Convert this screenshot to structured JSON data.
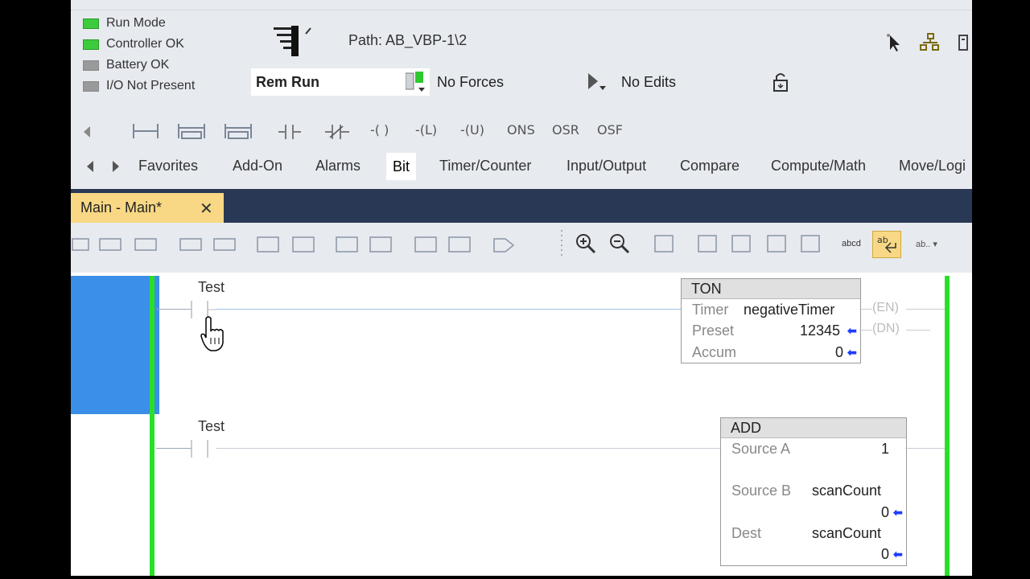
{
  "status": {
    "items": [
      {
        "label": "Run Mode",
        "color": "#3ccb3c"
      },
      {
        "label": "Controller OK",
        "color": "#3ccb3c"
      },
      {
        "label": "Battery OK",
        "color": "#9a9a9a"
      },
      {
        "label": "I/O Not Present",
        "color": "#9a9a9a"
      }
    ],
    "path": "Path:  AB_VBP-1\\2",
    "mode": "Rem Run",
    "forces": "No Forces",
    "edits": "No Edits"
  },
  "instructions": [
    "ONS",
    "OSR",
    "OSF"
  ],
  "palette_tabs": [
    "Favorites",
    "Add-On",
    "Alarms",
    "Bit",
    "Timer/Counter",
    "Input/Output",
    "Compare",
    "Compute/Math",
    "Move/Logi"
  ],
  "active_palette_tab": "Bit",
  "routine_tab": "Main - Main*",
  "rungs": [
    {
      "contact_tag": "Test",
      "block": {
        "title": "TON",
        "fields": [
          {
            "name": "Timer",
            "value": "negativeTimer"
          },
          {
            "name": "Preset",
            "value": "12345"
          },
          {
            "name": "Accum",
            "value": "0"
          }
        ],
        "outputs": [
          "EN",
          "DN"
        ]
      }
    },
    {
      "contact_tag": "Test",
      "block": {
        "title": "ADD",
        "fields": [
          {
            "name": "Source A",
            "value": "1"
          },
          {
            "name": "Source B",
            "value": "scanCount",
            "live": "0"
          },
          {
            "name": "Dest",
            "value": "scanCount",
            "live": "0"
          }
        ]
      }
    }
  ]
}
